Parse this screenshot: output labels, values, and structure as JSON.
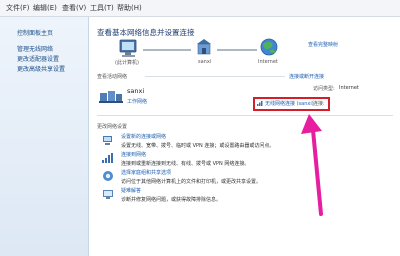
{
  "menu": [
    "文件(F)",
    "编辑(E)",
    "查看(V)",
    "工具(T)",
    "帮助(H)"
  ],
  "sidebar": {
    "title": "控制面板主页",
    "items": [
      "管理无线网络",
      "更改适配器设置",
      "更改高级共享设置"
    ]
  },
  "main": {
    "heading": "查看基本网络信息并设置连接",
    "full_map_link": "查看完整映射",
    "map": {
      "computer": "(此计算机)",
      "network": "sanxi",
      "internet": "Internet"
    },
    "active_label": "查看活动网络",
    "connect_disconnect": "连接或断开连接",
    "network_name": "sanxi",
    "network_type": "工作网络",
    "access_type_label": "访问类型:",
    "access_type_value": "Internet",
    "connections_label": "连接:",
    "connection_value": "无线网络连接 (sanxi)",
    "change_settings_title": "更改网络设置",
    "tasks": [
      {
        "title": "设置新的连接或网络",
        "desc": "设置无线、宽带、拨号、临时或 VPN 连接；或设置路由器或访问点。"
      },
      {
        "title": "连接到网络",
        "desc": "连接到或重新连接到无线、有线、拨号或 VPN 网络连接。"
      },
      {
        "title": "选择家庭组和共享选项",
        "desc": "访问位于其他网络计算机上的文件和打印机，或更改共享设置。"
      },
      {
        "title": "疑难解答",
        "desc": "诊断并修复网络问题，或获得故障排除信息。"
      }
    ]
  },
  "colors": {
    "accent": "#1e5fb0",
    "highlight": "#d61d2a",
    "arrow": "#e81ea0"
  }
}
